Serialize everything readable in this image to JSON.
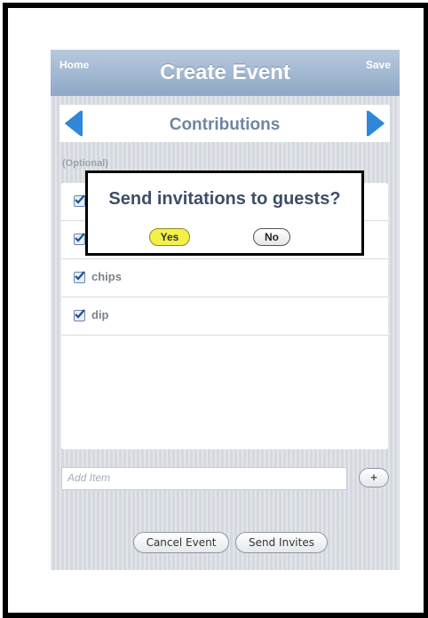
{
  "header": {
    "home_label": "Home",
    "title": "Create Event",
    "save_label": "Save"
  },
  "nav": {
    "title": "Contributions"
  },
  "section": {
    "label": "(Optional)"
  },
  "items": [
    {
      "label": "",
      "checked": true
    },
    {
      "label": "",
      "checked": true
    },
    {
      "label": "chips",
      "checked": true
    },
    {
      "label": "dip",
      "checked": true
    }
  ],
  "add_item": {
    "placeholder": "Add Item",
    "add_button": "+"
  },
  "footer": {
    "cancel_label": "Cancel Event",
    "send_label": "Send Invites"
  },
  "dialog": {
    "question": "Send invitations to guests?",
    "yes_label": "Yes",
    "no_label": "No"
  },
  "colors": {
    "titlebar": "#9fb6d2",
    "arrow": "#2f87d8",
    "nav_title": "#6f86a3",
    "yes_highlight": "#f3f04a"
  },
  "icons": {
    "left_arrow": "left-arrow-icon",
    "right_arrow": "right-arrow-icon",
    "checkbox": "checkbox-icon"
  }
}
